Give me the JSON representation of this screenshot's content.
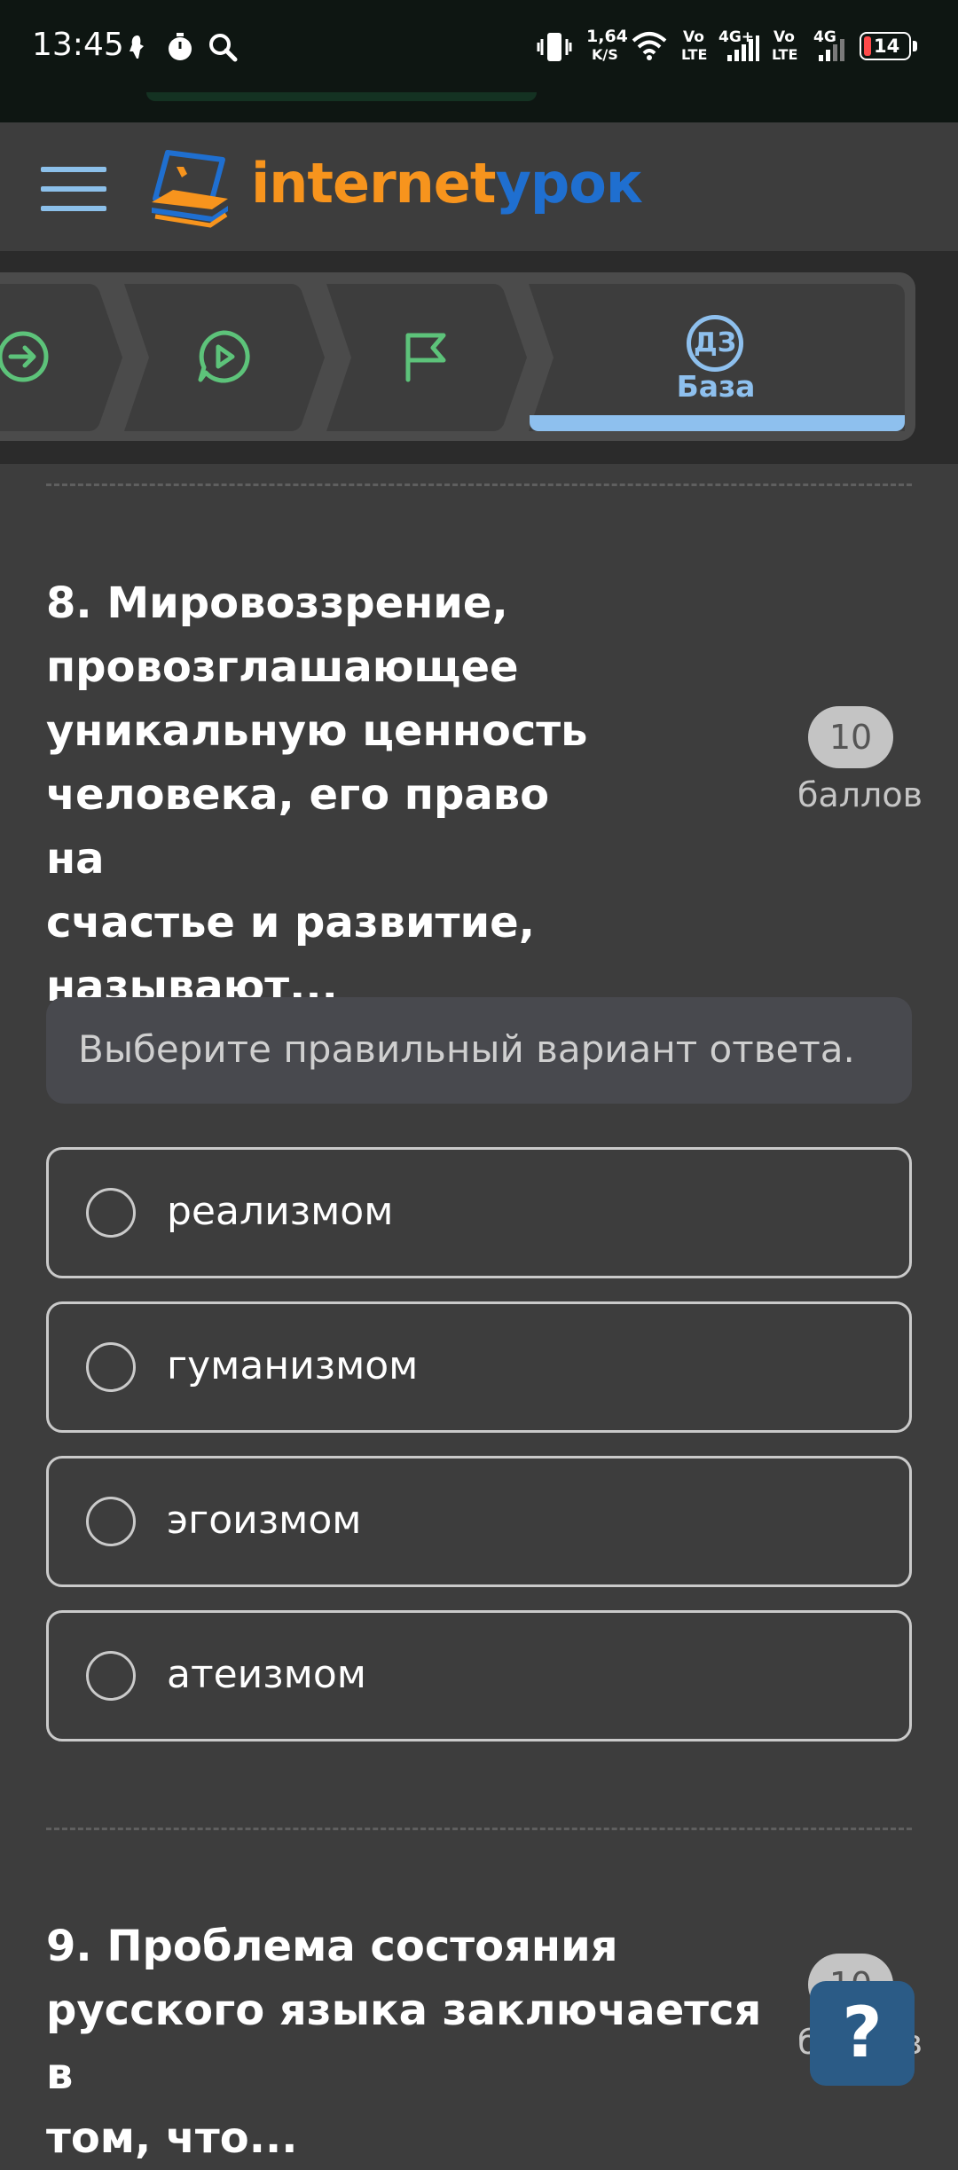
{
  "status_bar": {
    "time": "13:45",
    "network_speed_value": "1,64",
    "network_speed_unit": "K/S",
    "volte_1": "Vo",
    "lte_1": "LTE",
    "signal_1": "4G+",
    "volte_2": "Vo",
    "lte_2": "LTE",
    "signal_2": "4G",
    "battery": "14",
    "battery_color": "#ff4a4a",
    "icons": [
      "bug-icon",
      "timer-icon",
      "search-icon",
      "vibrate-icon",
      "wifi-icon",
      "signal-icon",
      "battery-icon"
    ]
  },
  "header": {
    "logo_part_1": "internet",
    "logo_part_2": "урок",
    "logo_color_1": "#f7941d",
    "logo_color_2": "#1f6fd0",
    "menu_icon": "hamburger-icon"
  },
  "steps": {
    "items": [
      {
        "icon": "arrow-circle-icon"
      },
      {
        "icon": "play-chat-icon"
      },
      {
        "icon": "flag-icon"
      },
      {
        "icon": "homework-badge-icon",
        "badge": "ДЗ",
        "label": "База",
        "active": true
      }
    ],
    "active_color": "#8ec0ee",
    "icon_color": "#5dc37a"
  },
  "question_8": {
    "lines": [
      "8. Мировоззрение,",
      "провозглашающее",
      "уникальную ценность",
      "человека, его право на",
      "счастье и развитие,",
      "называют..."
    ],
    "score": "10",
    "score_unit": "баллов",
    "instruction": "Выберите правильный вариант ответа.",
    "options": [
      "реализмом",
      "гуманизмом",
      "эгоизмом",
      "атеизмом"
    ]
  },
  "question_9": {
    "lines": [
      "9. Проблема состояния",
      "русского языка заключается в",
      "том, что..."
    ],
    "score": "10",
    "score_unit": "баллов"
  },
  "help_button": {
    "label": "?"
  }
}
